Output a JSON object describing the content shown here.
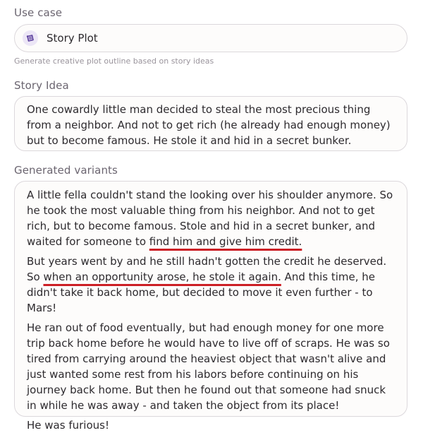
{
  "use_case": {
    "label": "Use case",
    "value": "Story Plot",
    "icon": "story-plot-icon",
    "helper": "Generate creative plot outline based on story ideas"
  },
  "story_idea": {
    "label": "Story Idea",
    "text": "One cowardly little man decided to steal the most precious thing from a neighbor. And not to get rich (he already had enough money) but to become famous. He stole it and hid in a secret bunker."
  },
  "generated": {
    "label": "Generated variants",
    "p1_before": "A little fella couldn't stand the looking over his shoulder anymore. So he took the most valuable thing from his neighbor. And not to get rich, but to become famous. Stole and hid in a secret bunker, and waited for someone to ",
    "p1_highlight": "find him and give him credit.",
    "p2_before": "But years went by and he still hadn't gotten the credit he deserved. So ",
    "p2_highlight": "when an opportunity arose, he stole it again.",
    "p2_after": " And this time, he didn't take it back home, but decided to move it even further - to Mars!",
    "p3": "He ran out of food eventually, but had enough money for one more trip back home before he would have to live off of scraps. He was so tired from carrying around the heaviest object that wasn't alive and just wanted some rest from his labors before continuing on his journey back home. But then he found out that someone had snuck in while he was away - and taken the object from its place!",
    "p4": "He was furious!",
    "underline_color": "#cc1f25"
  }
}
